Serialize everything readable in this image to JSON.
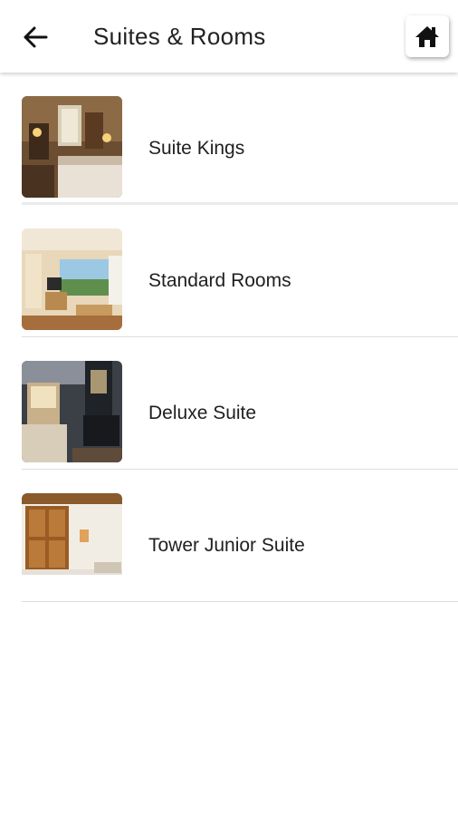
{
  "app_bar": {
    "title": "Suites & Rooms",
    "back_icon": "arrow-left-icon",
    "home_icon": "home-icon"
  },
  "rooms": [
    {
      "label": "Suite Kings",
      "thumbnail": "suite-kings-photo"
    },
    {
      "label": "Standard Rooms",
      "thumbnail": "standard-rooms-photo"
    },
    {
      "label": "Deluxe Suite",
      "thumbnail": "deluxe-suite-photo"
    },
    {
      "label": "Tower Junior Suite",
      "thumbnail": "tower-junior-suite-photo"
    }
  ],
  "colors": {
    "background": "#ffffff",
    "text": "#1f1f1f",
    "divider": "#dcdcdc"
  }
}
